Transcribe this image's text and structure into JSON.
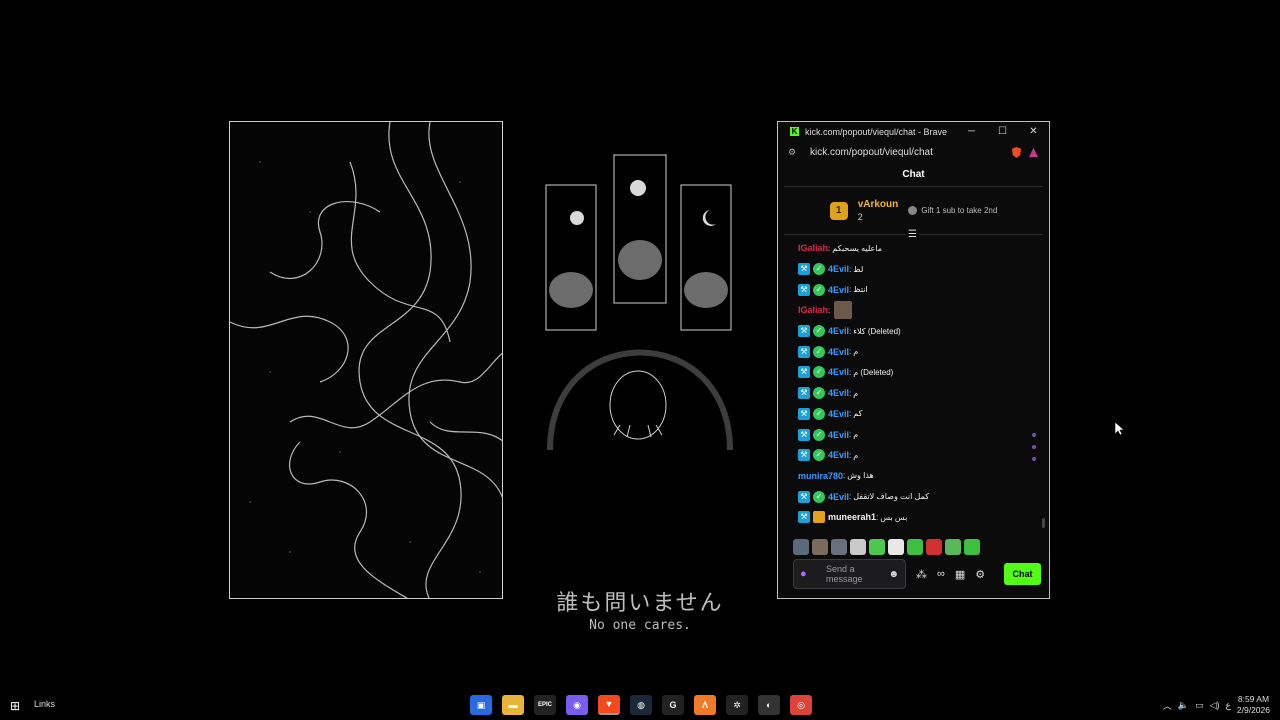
{
  "desktop": {
    "caption_jp": "誰も問いません",
    "caption_en": "No one cares."
  },
  "browser": {
    "title": "kick.com/popout/viequl/chat - Brave",
    "url": "kick.com/popout/viequl/chat",
    "win_min": "─",
    "win_max": "☐",
    "win_close": "✕"
  },
  "chat": {
    "header": "Chat",
    "top_gifter": {
      "rank": "1",
      "name": "vArkoun",
      "count": "2",
      "cta": "Gift 1 sub to take 2nd"
    },
    "messages": [
      {
        "user": "IGaliah",
        "color": "#e2264d",
        "badges": [],
        "text": "ماعليه يسحبكم"
      },
      {
        "user": "4Evil",
        "color": "#3b9cff",
        "badges": [
          "mod",
          "verified"
        ],
        "text": "لط"
      },
      {
        "user": "4Evil",
        "color": "#3b9cff",
        "badges": [
          "mod",
          "verified"
        ],
        "text": "انتظ"
      },
      {
        "user": "IGaliah",
        "color": "#e2264d",
        "badges": [],
        "text": "",
        "emote": true
      },
      {
        "user": "4Evil",
        "color": "#3b9cff",
        "badges": [
          "mod",
          "verified"
        ],
        "text": "كلاء (Deleted)"
      },
      {
        "user": "4Evil",
        "color": "#3b9cff",
        "badges": [
          "mod",
          "verified"
        ],
        "text": "م"
      },
      {
        "user": "4Evil",
        "color": "#3b9cff",
        "badges": [
          "mod",
          "verified"
        ],
        "text": "م (Deleted)"
      },
      {
        "user": "4Evil",
        "color": "#3b9cff",
        "badges": [
          "mod",
          "verified"
        ],
        "text": "م"
      },
      {
        "user": "4Evil",
        "color": "#3b9cff",
        "badges": [
          "mod",
          "verified"
        ],
        "text": "كم"
      },
      {
        "user": "4Evil",
        "color": "#3b9cff",
        "badges": [
          "mod",
          "verified"
        ],
        "text": "م"
      },
      {
        "user": "4Evil",
        "color": "#3b9cff",
        "badges": [
          "mod",
          "verified"
        ],
        "text": "م"
      },
      {
        "user": "munira780",
        "color": "#3b9cff",
        "badges": [],
        "text": "هذا وش"
      },
      {
        "user": "4Evil",
        "color": "#3b9cff",
        "badges": [
          "mod",
          "verified"
        ],
        "text": "كمل انت وصاف لاتقفل"
      },
      {
        "user": "muneerah1",
        "color": "#f3f3f3",
        "badges": [
          "mod",
          "sub"
        ],
        "text": "بس بس"
      }
    ],
    "emote_colors": [
      "#5a6a7a",
      "#7b6b5b",
      "#6a6f7f",
      "#c9c9c9",
      "#4cc94c",
      "#e8e8e8",
      "#3fbf3f",
      "#d03030",
      "#5ab85a",
      "#3fbf3f"
    ],
    "input_placeholder": "Send a message",
    "send_label": "Chat",
    "mic_icon": "microphone-icon",
    "accent": "#53fc18"
  },
  "taskbar": {
    "links_label": "Links",
    "lang": "ع",
    "time": "8:59 AM",
    "date": "2/9/2026",
    "apps": [
      {
        "name": "store-icon",
        "glyph": "▣",
        "color": "#2a6ae0"
      },
      {
        "name": "file-explorer-icon",
        "glyph": "▬",
        "color": "#e8b33a"
      },
      {
        "name": "epic-games-icon",
        "glyph": "EPIC",
        "color": "#222"
      },
      {
        "name": "messenger-icon",
        "glyph": "◉",
        "color": "#7b5cf0"
      },
      {
        "name": "brave-icon",
        "glyph": "▼",
        "color": "#f24a1d"
      },
      {
        "name": "steam-icon",
        "glyph": "◍",
        "color": "#1b2838"
      },
      {
        "name": "g-hub-icon",
        "glyph": "G",
        "color": "#222"
      },
      {
        "name": "app-a-icon",
        "glyph": "Λ",
        "color": "#f07a2a"
      },
      {
        "name": "steelseries-icon",
        "glyph": "✲",
        "color": "#222"
      },
      {
        "name": "obs-icon",
        "glyph": "◐",
        "color": "#333"
      },
      {
        "name": "chrome-icon",
        "glyph": "◎",
        "color": "#db4437"
      }
    ]
  }
}
